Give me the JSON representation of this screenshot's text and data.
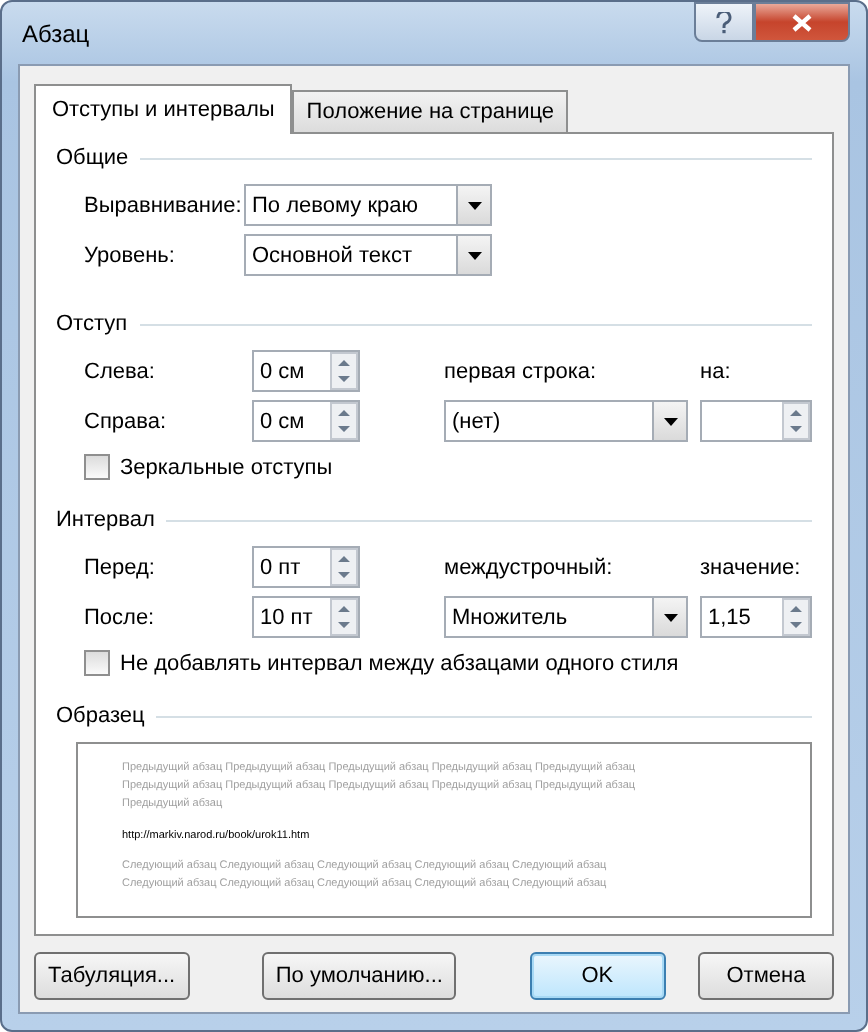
{
  "window": {
    "title": "Абзац"
  },
  "tabs": [
    {
      "label": "Отступы и интервалы",
      "selected": true
    },
    {
      "label": "Положение на странице",
      "selected": false
    }
  ],
  "general": {
    "title": "Общие",
    "fields": [
      {
        "label": "Выравнивание:",
        "value": "По левому краю"
      },
      {
        "label": "Уровень:",
        "value": "Основной текст"
      }
    ]
  },
  "indent": {
    "title": "Отступ",
    "left": {
      "label": "Слева:",
      "value": "0 см"
    },
    "right": {
      "label": "Справа:",
      "value": "0 см"
    },
    "first_line": {
      "label": "первая строка:",
      "value": "(нет)"
    },
    "by": {
      "label": "на:"
    },
    "mirror": {
      "label": "Зеркальные отступы",
      "checked": false
    }
  },
  "spacing": {
    "title": "Интервал",
    "before": {
      "label": "Перед:",
      "value": "0 пт"
    },
    "after": {
      "label": "После:",
      "value": "10 пт"
    },
    "line_spacing": {
      "label": "междустрочный:",
      "value": "Множитель"
    },
    "at": {
      "label": "значение:",
      "value": "1,15"
    },
    "no_space": {
      "label": "Не добавлять интервал между абзацами одного стиля",
      "checked": false
    }
  },
  "preview": {
    "title": "Образец",
    "previous_lines": [
      "Предыдущий абзац Предыдущий абзац Предыдущий абзац Предыдущий абзац Предыдущий абзац",
      "Предыдущий абзац Предыдущий абзац Предыдущий абзац Предыдущий абзац Предыдущий абзац",
      "Предыдущий абзац"
    ],
    "sample": "http://markiv.narod.ru/book/urok11.htm",
    "next_lines": [
      "Следующий абзац Следующий абзац Следующий абзац Следующий абзац Следующий абзац",
      "Следующий абзац Следующий абзац Следующий абзац Следующий абзац Следующий абзац"
    ]
  },
  "buttons": [
    {
      "label": "Табуляция...",
      "kind": "normal"
    },
    {
      "label": "По умолчанию...",
      "kind": "normal"
    },
    {
      "label": "OK",
      "kind": "default"
    },
    {
      "label": "Отмена",
      "kind": "normal"
    }
  ]
}
